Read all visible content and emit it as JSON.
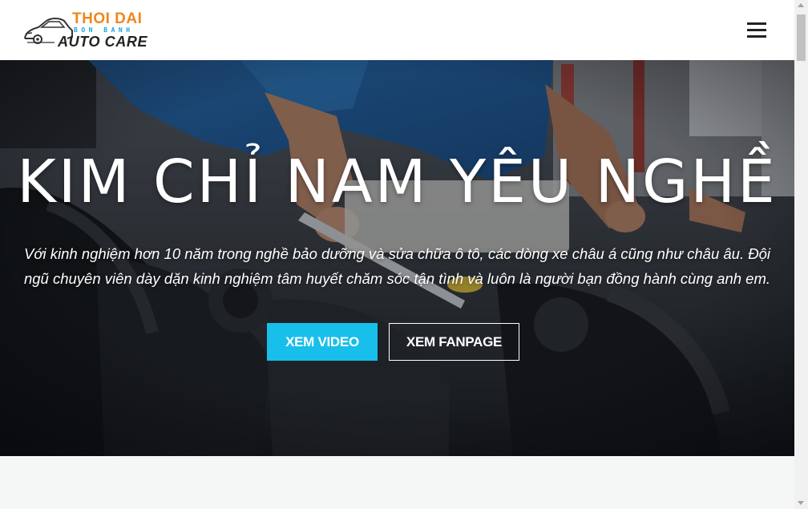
{
  "logo": {
    "line1": "THOI DAI",
    "line2": "BON BANH",
    "line3": "AUTO CARE"
  },
  "header": {
    "menu_icon": "hamburger-icon"
  },
  "hero": {
    "title": "KIM CHỈ NAM YÊU NGHỀ",
    "subtitle": "Với kinh nghiệm hơn 10 năm trong nghề bảo dưỡng và sửa chữa ô tô, các dòng xe châu á cũng như châu âu. Đội ngũ chuyên viên dày dặn kinh nghiệm tâm huyết chăm sóc tận tình và luôn là người bạn đồng hành cùng anh em.",
    "buttons": {
      "video_label": "XEM VIDEO",
      "fanpage_label": "XEM FANPAGE"
    }
  },
  "colors": {
    "accent": "#17bfea",
    "logo_orange": "#f0861c",
    "logo_blue": "#1aa3d8"
  }
}
